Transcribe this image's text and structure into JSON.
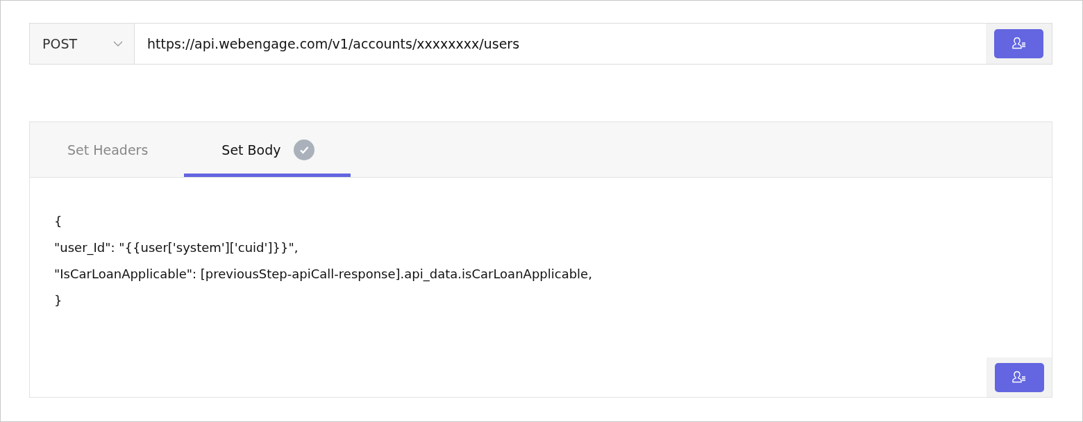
{
  "request": {
    "method": "POST",
    "url": "https://api.webengage.com/v1/accounts/xxxxxxxx/users"
  },
  "tabs": [
    {
      "label": "Set Headers",
      "selected": false,
      "done": false
    },
    {
      "label": "Set Body",
      "selected": true,
      "done": true
    }
  ],
  "body_lines": [
    "{",
    "\"user_Id\": \"{{user['system']['cuid']}}\",",
    "\"IsCarLoanApplicable\": [previousStep-apiCall-response].api_data.isCarLoanApplicable,",
    "}"
  ]
}
